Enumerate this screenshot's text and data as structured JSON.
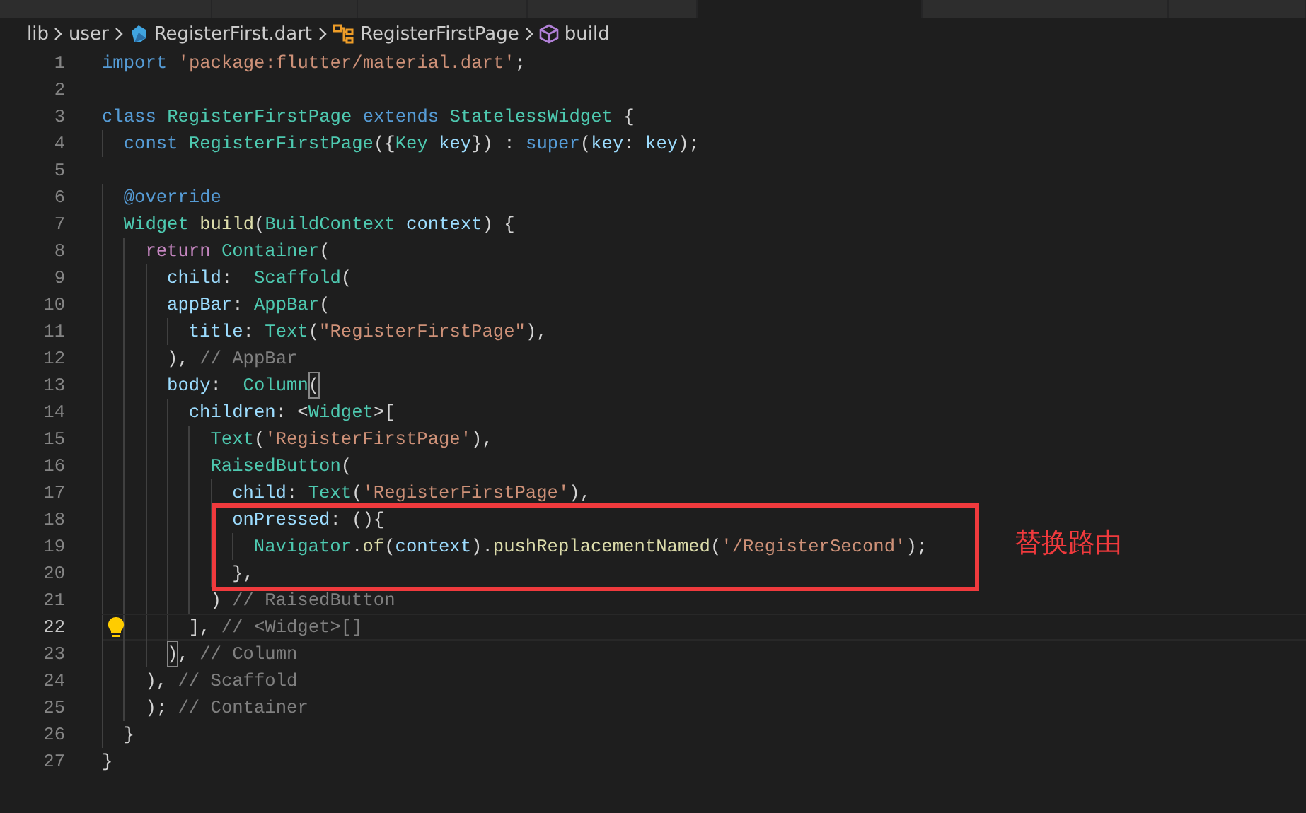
{
  "tabs": [
    {
      "selected": false
    },
    {
      "selected": false
    },
    {
      "selected": false
    },
    {
      "selected": false
    },
    {
      "selected": true
    },
    {
      "selected": false
    },
    {
      "selected": false
    }
  ],
  "breadcrumb": [
    {
      "kind": "folder",
      "label": "lib"
    },
    {
      "kind": "folder",
      "label": "user"
    },
    {
      "kind": "file",
      "label": "RegisterFirst.dart"
    },
    {
      "kind": "class",
      "label": "RegisterFirstPage"
    },
    {
      "kind": "method",
      "label": "build"
    }
  ],
  "code_lines": [
    {
      "number": "1",
      "current": false,
      "tokens": [
        {
          "kind": "kw",
          "text": "import "
        },
        {
          "kind": "str",
          "text": "'package:flutter/material.dart'"
        },
        {
          "kind": "p",
          "text": ";"
        }
      ]
    },
    {
      "number": "2",
      "current": false
    },
    {
      "number": "3",
      "current": false,
      "tokens": [
        {
          "kind": "kw",
          "text": "class "
        },
        {
          "kind": "type",
          "text": "RegisterFirstPage "
        },
        {
          "kind": "kw",
          "text": "extends "
        },
        {
          "kind": "type",
          "text": "StatelessWidget "
        },
        {
          "kind": "p",
          "text": "{"
        }
      ]
    },
    {
      "number": "4",
      "current": false,
      "tokens": [
        {
          "kind": "kw",
          "text": "  const "
        },
        {
          "kind": "type",
          "text": "RegisterFirstPage"
        },
        {
          "kind": "p",
          "text": "({"
        },
        {
          "kind": "type",
          "text": "Key "
        },
        {
          "kind": "var",
          "text": "key"
        },
        {
          "kind": "p",
          "text": "}) : "
        },
        {
          "kind": "kw",
          "text": "super"
        },
        {
          "kind": "p",
          "text": "("
        },
        {
          "kind": "var",
          "text": "key"
        },
        {
          "kind": "p",
          "text": ": "
        },
        {
          "kind": "var",
          "text": "key"
        },
        {
          "kind": "p",
          "text": ");"
        }
      ]
    },
    {
      "number": "5",
      "current": false
    },
    {
      "number": "6",
      "current": false,
      "tokens": [
        {
          "kind": "kw",
          "text": "  @override"
        }
      ]
    },
    {
      "number": "7",
      "current": false,
      "tokens": [
        {
          "kind": "type",
          "text": "  Widget "
        },
        {
          "kind": "fn",
          "text": "build"
        },
        {
          "kind": "p",
          "text": "("
        },
        {
          "kind": "type",
          "text": "BuildContext "
        },
        {
          "kind": "var",
          "text": "context"
        },
        {
          "kind": "p",
          "text": ") {"
        }
      ]
    },
    {
      "number": "8",
      "current": false,
      "tokens": [
        {
          "kind": "ctrl",
          "text": "    return "
        },
        {
          "kind": "type",
          "text": "Container"
        },
        {
          "kind": "p",
          "text": "("
        }
      ]
    },
    {
      "number": "9",
      "current": false,
      "tokens": [
        {
          "kind": "var",
          "text": "      child"
        },
        {
          "kind": "p",
          "text": ":  "
        },
        {
          "kind": "type",
          "text": "Scaffold"
        },
        {
          "kind": "p",
          "text": "("
        }
      ]
    },
    {
      "number": "10",
      "current": false,
      "tokens": [
        {
          "kind": "var",
          "text": "      appBar"
        },
        {
          "kind": "p",
          "text": ": "
        },
        {
          "kind": "type",
          "text": "AppBar"
        },
        {
          "kind": "p",
          "text": "("
        }
      ]
    },
    {
      "number": "11",
      "current": false,
      "tokens": [
        {
          "kind": "var",
          "text": "        title"
        },
        {
          "kind": "p",
          "text": ": "
        },
        {
          "kind": "type",
          "text": "Text"
        },
        {
          "kind": "p",
          "text": "("
        },
        {
          "kind": "str",
          "text": "\"RegisterFirstPage\""
        },
        {
          "kind": "p",
          "text": "),"
        }
      ]
    },
    {
      "number": "12",
      "current": false,
      "tokens": [
        {
          "kind": "p",
          "text": "      ), "
        },
        {
          "kind": "cmt",
          "text": "// AppBar"
        }
      ]
    },
    {
      "number": "13",
      "current": false,
      "tokens": [
        {
          "kind": "var",
          "text": "      body"
        },
        {
          "kind": "p",
          "text": ":  "
        },
        {
          "kind": "type",
          "text": "Column"
        },
        {
          "kind": "match",
          "text": "("
        }
      ]
    },
    {
      "number": "14",
      "current": false,
      "tokens": [
        {
          "kind": "var",
          "text": "        children"
        },
        {
          "kind": "p",
          "text": ": <"
        },
        {
          "kind": "type",
          "text": "Widget"
        },
        {
          "kind": "p",
          "text": ">["
        }
      ]
    },
    {
      "number": "15",
      "current": false,
      "tokens": [
        {
          "kind": "type",
          "text": "          Text"
        },
        {
          "kind": "p",
          "text": "("
        },
        {
          "kind": "str",
          "text": "'RegisterFirstPage'"
        },
        {
          "kind": "p",
          "text": "),"
        }
      ]
    },
    {
      "number": "16",
      "current": false,
      "tokens": [
        {
          "kind": "type",
          "text": "          RaisedButton"
        },
        {
          "kind": "p",
          "text": "("
        }
      ]
    },
    {
      "number": "17",
      "current": false,
      "tokens": [
        {
          "kind": "var",
          "text": "            child"
        },
        {
          "kind": "p",
          "text": ": "
        },
        {
          "kind": "type",
          "text": "Text"
        },
        {
          "kind": "p",
          "text": "("
        },
        {
          "kind": "str",
          "text": "'RegisterFirstPage'"
        },
        {
          "kind": "p",
          "text": "),"
        }
      ]
    },
    {
      "number": "18",
      "current": false,
      "tokens": [
        {
          "kind": "var",
          "text": "            onPressed"
        },
        {
          "kind": "p",
          "text": ": (){"
        }
      ]
    },
    {
      "number": "19",
      "current": false,
      "tokens": [
        {
          "kind": "type",
          "text": "              Navigator"
        },
        {
          "kind": "p",
          "text": "."
        },
        {
          "kind": "fn",
          "text": "of"
        },
        {
          "kind": "p",
          "text": "("
        },
        {
          "kind": "var",
          "text": "context"
        },
        {
          "kind": "p",
          "text": ")."
        },
        {
          "kind": "fn",
          "text": "pushReplacementNamed"
        },
        {
          "kind": "p",
          "text": "("
        },
        {
          "kind": "str",
          "text": "'/RegisterSecond'"
        },
        {
          "kind": "p",
          "text": ");"
        }
      ]
    },
    {
      "number": "20",
      "current": false,
      "tokens": [
        {
          "kind": "p",
          "text": "            },"
        }
      ]
    },
    {
      "number": "21",
      "current": false,
      "tokens": [
        {
          "kind": "p",
          "text": "          ) "
        },
        {
          "kind": "cmt",
          "text": "// RaisedButton"
        }
      ]
    },
    {
      "number": "22",
      "current": true,
      "tokens": [
        {
          "kind": "p",
          "text": "        ], "
        },
        {
          "kind": "cmt",
          "text": "// <Widget>[]"
        }
      ]
    },
    {
      "number": "23",
      "current": false,
      "tokens": [
        {
          "kind": "match",
          "text": "      )"
        },
        {
          "kind": "p",
          "text": ", "
        },
        {
          "kind": "cmt",
          "text": "// Column"
        }
      ]
    },
    {
      "number": "24",
      "current": false,
      "tokens": [
        {
          "kind": "p",
          "text": "    ), "
        },
        {
          "kind": "cmt",
          "text": "// Scaffold"
        }
      ]
    },
    {
      "number": "25",
      "current": false,
      "tokens": [
        {
          "kind": "p",
          "text": "    ); "
        },
        {
          "kind": "cmt",
          "text": "// Container"
        }
      ]
    },
    {
      "number": "26",
      "current": false,
      "tokens": [
        {
          "kind": "p",
          "text": "  }"
        }
      ]
    },
    {
      "number": "27",
      "current": false,
      "tokens": [
        {
          "kind": "p",
          "text": "}"
        }
      ]
    }
  ],
  "annotation": {
    "text": "替换路由"
  }
}
